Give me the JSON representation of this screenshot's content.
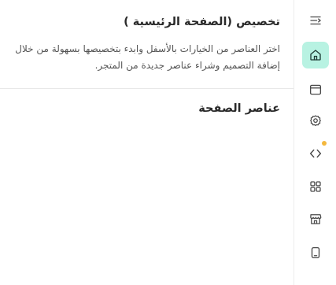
{
  "header": {
    "title": "تخصيص (الصفحة الرئيسية )",
    "description": "اختر العناصر من الخيارات بالأسفل وابدء بتخصيصها بسهولة من خلال إضافة التصميم وشراء عناصر جديدة من المتجر."
  },
  "section": {
    "title": "عناصر الصفحة"
  },
  "sidebar": {
    "items": [
      {
        "icon": "menu-collapse-icon",
        "active": false
      },
      {
        "icon": "home-icon",
        "active": true
      },
      {
        "icon": "browser-window-icon",
        "active": false
      },
      {
        "icon": "gear-icon",
        "active": false
      },
      {
        "icon": "code-icon",
        "active": false,
        "notification": true
      },
      {
        "icon": "apps-grid-icon",
        "active": false
      },
      {
        "icon": "store-icon",
        "active": false
      },
      {
        "icon": "mobile-icon",
        "active": false
      }
    ]
  },
  "colors": {
    "active_bg": "#b8f2e2",
    "notification_dot": "#f4b83e",
    "icon": "#4a4a4a"
  }
}
